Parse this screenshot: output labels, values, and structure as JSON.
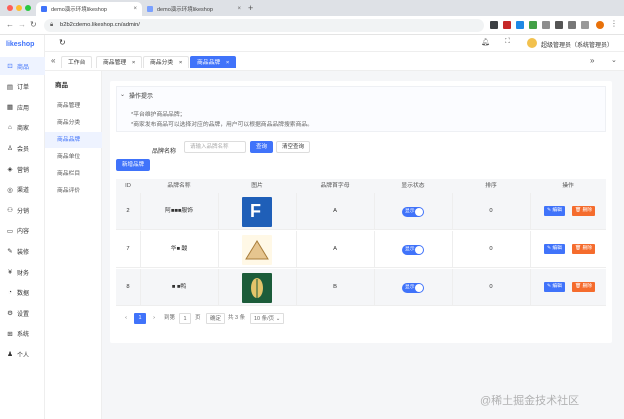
{
  "colors": {
    "accent": "#4073fa",
    "danger": "#f56c2d",
    "row_alt": "#f5f6f8"
  },
  "browser": {
    "tabs": [
      {
        "title": "demo演示环境likeshop",
        "active": true
      },
      {
        "title": "demo演示环境likeshop",
        "active": false
      }
    ],
    "url": "b2b2cdemo.likeshop.cn/admin/"
  },
  "app": {
    "logo": "likeshop"
  },
  "sidebar": {
    "items": [
      {
        "label": "商品",
        "icon": "bag-icon",
        "glyph": "⊡",
        "active": true
      },
      {
        "label": "订单",
        "icon": "order-icon",
        "glyph": "▤"
      },
      {
        "label": "应用",
        "icon": "apps-icon",
        "glyph": "▦"
      },
      {
        "label": "商家",
        "icon": "shop-icon",
        "glyph": "⌂"
      },
      {
        "label": "会员",
        "icon": "user-icon",
        "glyph": "♙"
      },
      {
        "label": "营销",
        "icon": "marketing-icon",
        "glyph": "◈"
      },
      {
        "label": "渠道",
        "icon": "channel-icon",
        "glyph": "◎"
      },
      {
        "label": "分销",
        "icon": "distribution-icon",
        "glyph": "⚇"
      },
      {
        "label": "内容",
        "icon": "content-icon",
        "glyph": "▭"
      },
      {
        "label": "装修",
        "icon": "decorate-icon",
        "glyph": "✎"
      },
      {
        "label": "财务",
        "icon": "finance-icon",
        "glyph": "¥"
      },
      {
        "label": "数据",
        "icon": "data-icon",
        "glyph": "◔"
      },
      {
        "label": "设置",
        "icon": "settings-icon",
        "glyph": "⚙"
      },
      {
        "label": "系统",
        "icon": "system-icon",
        "glyph": "⊞"
      },
      {
        "label": "个人",
        "icon": "person-icon",
        "glyph": "♟"
      }
    ]
  },
  "header": {
    "user": "超级管理员（系统管理员）"
  },
  "page_tabs": [
    {
      "label": "工作台",
      "active": false,
      "closable": false
    },
    {
      "label": "商品管理",
      "active": false,
      "closable": true
    },
    {
      "label": "商品分类",
      "active": false,
      "closable": true
    },
    {
      "label": "商品品牌",
      "active": true,
      "closable": true
    }
  ],
  "subnav": {
    "title": "商品",
    "items": [
      {
        "label": "商品管理",
        "active": false
      },
      {
        "label": "商品分类",
        "active": false
      },
      {
        "label": "商品品牌",
        "active": true
      },
      {
        "label": "商品单位",
        "active": false
      },
      {
        "label": "商品栏目",
        "active": false
      },
      {
        "label": "商品评价",
        "active": false
      }
    ]
  },
  "tips": {
    "title": "操作提示",
    "lines": [
      "*平台维护商品品牌；",
      "*商家发布商品可以选择对应的品牌，用户可以根据商品品牌搜索商品。"
    ]
  },
  "search": {
    "label": "品牌名称",
    "placeholder": "请输入品牌名称",
    "search_btn": "查询",
    "reset_btn": "清空查询",
    "add_btn": "新增品牌"
  },
  "table": {
    "columns": [
      "ID",
      "品牌名称",
      "图片",
      "品牌首字母",
      "显示状态",
      "排序",
      "操作"
    ],
    "rows": [
      {
        "id": "2",
        "name": "阿■■■服饰",
        "image": "f-logo",
        "letter": "A",
        "status": "显示",
        "sort": "0"
      },
      {
        "id": "7",
        "name": "华■   酸",
        "image": "tent-logo",
        "letter": "A",
        "status": "显示",
        "sort": "0"
      },
      {
        "id": "8",
        "name": "■ ■鸭",
        "image": "leaf-logo",
        "letter": "B",
        "status": "显示",
        "sort": "0"
      }
    ],
    "edit_label": "编辑",
    "delete_label": "删除"
  },
  "pagination": {
    "prev": "‹",
    "current": "1",
    "next": "›",
    "goto_label": "到第",
    "goto_value": "1",
    "page_unit": "页",
    "confirm": "确定",
    "total": "共 3 条",
    "page_size": "10 条/页"
  },
  "watermark": "@稀土掘金技术社区"
}
